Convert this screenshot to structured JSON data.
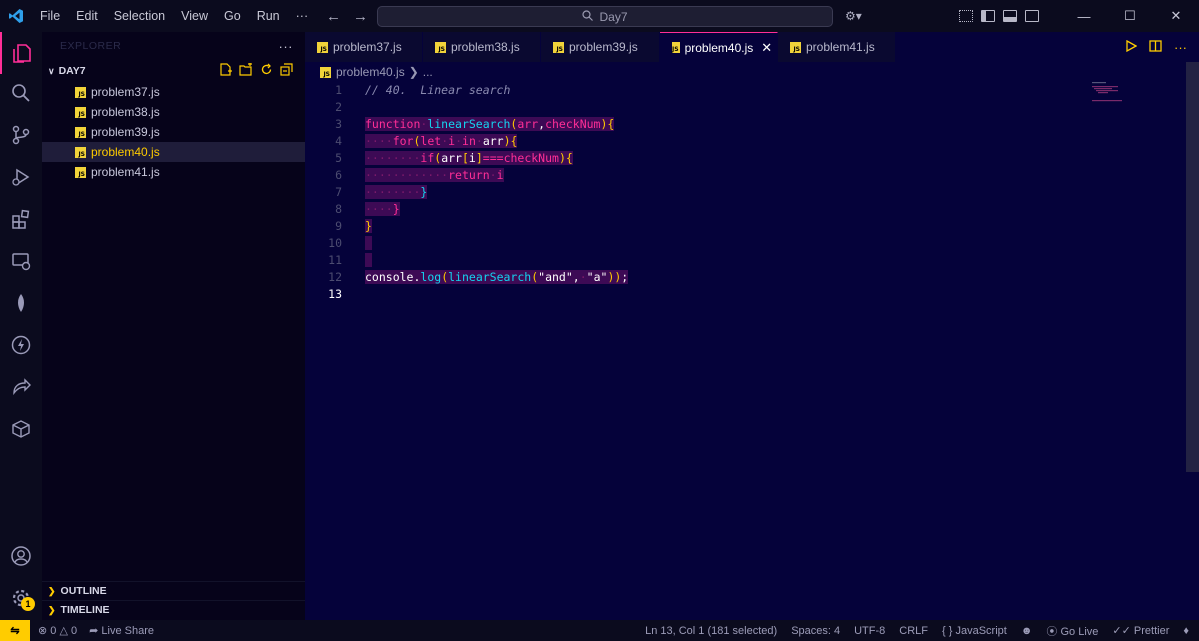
{
  "titlebar": {
    "menu": [
      "File",
      "Edit",
      "Selection",
      "View",
      "Go",
      "Run",
      "···"
    ],
    "search_text": "Day7"
  },
  "sidebar": {
    "header": "EXPLORER",
    "folder": "DAY7",
    "files": [
      {
        "name": "problem37.js",
        "selected": false
      },
      {
        "name": "problem38.js",
        "selected": false
      },
      {
        "name": "problem39.js",
        "selected": false
      },
      {
        "name": "problem40.js",
        "selected": true
      },
      {
        "name": "problem41.js",
        "selected": false
      }
    ],
    "outline_label": "OUTLINE",
    "timeline_label": "TIMELINE",
    "accounts_badge": "1"
  },
  "tabs": [
    {
      "label": "problem37.js",
      "active": false
    },
    {
      "label": "problem38.js",
      "active": false
    },
    {
      "label": "problem39.js",
      "active": false
    },
    {
      "label": "problem40.js",
      "active": true
    },
    {
      "label": "problem41.js",
      "active": false
    }
  ],
  "breadcrumb": {
    "file": "problem40.js",
    "rest": "..."
  },
  "editor": {
    "line_numbers": [
      "1",
      "2",
      "3",
      "4",
      "5",
      "6",
      "7",
      "8",
      "9",
      "10",
      "11",
      "12",
      "13"
    ],
    "current_line": "13"
  },
  "statusbar": {
    "errors": "0",
    "warnings": "0",
    "live_share": "Live Share",
    "position": "Ln 13, Col 1 (181 selected)",
    "spaces": "Spaces: 4",
    "encoding": "UTF-8",
    "eol": "CRLF",
    "language": "JavaScript",
    "go_live": "Go Live",
    "prettier": "Prettier"
  },
  "colors": {
    "accent_pink": "#ff2e97",
    "accent_yellow": "#ffcc00",
    "editor_bg": "#05023a"
  }
}
